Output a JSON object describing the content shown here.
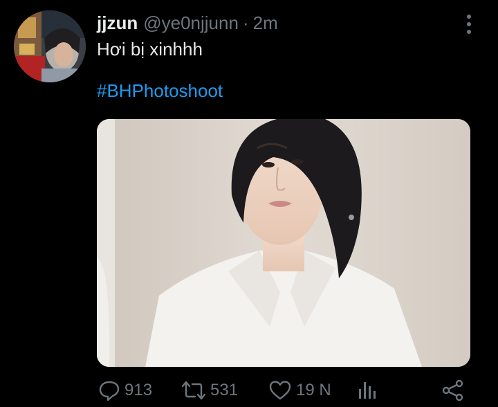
{
  "tweet": {
    "display_name": "jjzun",
    "handle": "@ye0njjunn",
    "separator": "·",
    "time": "2m",
    "text": "Hơi bị xinhhh",
    "hashtag": "#BHPhotoshoot"
  },
  "actions": {
    "replies": "913",
    "retweets": "531",
    "likes": "19 N"
  },
  "icons": {
    "more": "more-vertical-icon",
    "reply": "reply-icon",
    "retweet": "retweet-icon",
    "like": "heart-icon",
    "stats": "analytics-icon",
    "share": "share-icon"
  },
  "colors": {
    "background": "#000000",
    "primary_text": "#e7e9ea",
    "secondary_text": "#6e767d",
    "link": "#1d9bf0"
  }
}
